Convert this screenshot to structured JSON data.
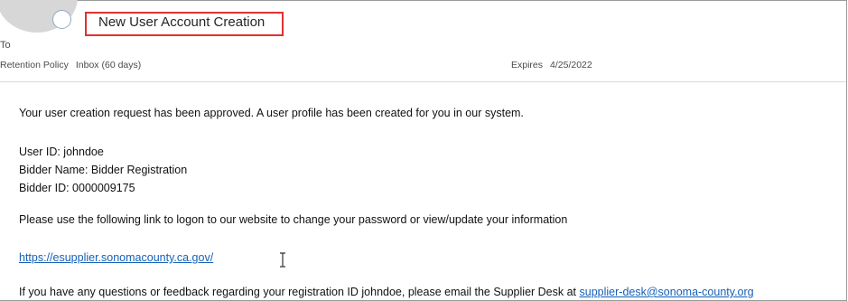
{
  "header": {
    "subject": "New User Account Creation",
    "to_label": "To",
    "retention_policy": "Retention Policy",
    "retention_folder": "Inbox (60 days)",
    "expires_label": "Expires",
    "expires_date": "4/25/2022"
  },
  "message": {
    "intro": "Your user creation request has been approved.  A user profile has been created for you in our system.",
    "user_id": "User ID:  johndoe",
    "bidder_name": "Bidder Name:  Bidder Registration",
    "bidder_id": "Bidder ID:  0000009175",
    "instructions": "Please use the following link to logon to our website to change your password or view/update your information",
    "url": "https://esupplier.sonomacounty.ca.gov/",
    "footer_text": "If you have any questions or feedback regarding your registration ID johndoe, please email the Supplier Desk at ",
    "support_email": "supplier-desk@sonoma-county.org"
  },
  "colors": {
    "highlight_box": "#e0312f",
    "link": "#1560b8"
  },
  "icons": {
    "cursor": "text-cursor-icon",
    "avatar": "sender-avatar-icon"
  }
}
